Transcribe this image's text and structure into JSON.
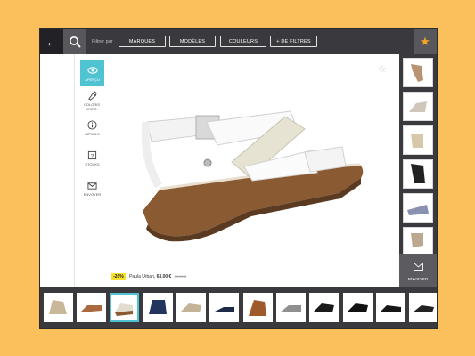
{
  "topbar": {
    "back_icon": "arrow-left-icon",
    "search_icon": "search-icon",
    "filter_label": "Filtrer par",
    "filters": [
      "MARQUES",
      "MODÈLES",
      "COULEURS",
      "+ DE FILTRES"
    ],
    "favorites_icon": "star-icon"
  },
  "sidemenu": {
    "items": [
      {
        "label": "APERÇU",
        "icon": "eye-icon",
        "active": true
      },
      {
        "label": "COLORIS DISPO.",
        "icon": "paint-icon",
        "active": false
      },
      {
        "label": "DÉTAILS",
        "icon": "info-icon",
        "active": false
      },
      {
        "label": "STOCKS",
        "icon": "question-icon",
        "active": false
      },
      {
        "label": "ENVOYER",
        "icon": "mail-icon",
        "active": false
      }
    ]
  },
  "product": {
    "discount": "-20%",
    "name": "Paula Urban,",
    "price": "63.00 €",
    "old_price": "79.00 €"
  },
  "right_panel": {
    "send_label": "ENVOYER",
    "send_icon": "mail-icon"
  },
  "colors": {
    "accent": "#4fc3d2",
    "bar": "#3a3a3e",
    "background": "#fbbf5c",
    "star": "#f5a623"
  }
}
